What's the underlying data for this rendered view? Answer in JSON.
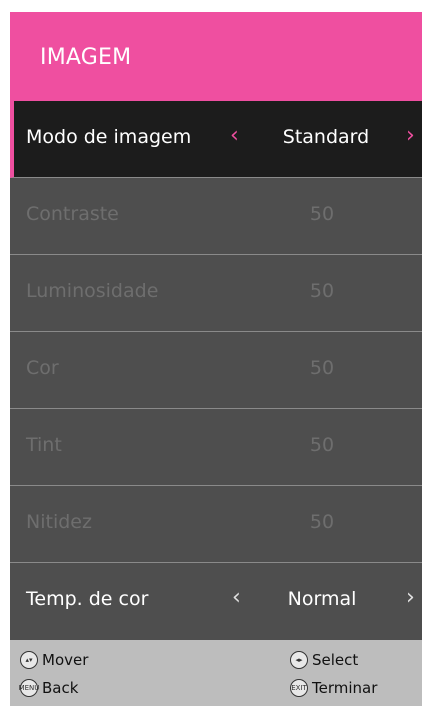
{
  "menu": {
    "title": "IMAGEM",
    "items": [
      {
        "label": "Modo de imagem",
        "value": "Standard",
        "state": "active",
        "arrows": true
      },
      {
        "label": "Contraste",
        "value": "50",
        "state": "dim",
        "arrows": false
      },
      {
        "label": "Luminosidade",
        "value": "50",
        "state": "dim",
        "arrows": false
      },
      {
        "label": "Cor",
        "value": "50",
        "state": "dim",
        "arrows": false
      },
      {
        "label": "Tint",
        "value": "50",
        "state": "dim",
        "arrows": false
      },
      {
        "label": "Nitidez",
        "value": "50",
        "state": "dim",
        "arrows": false
      },
      {
        "label": "Temp. de cor",
        "value": "Normal",
        "state": "normal",
        "arrows": true
      }
    ]
  },
  "footer": {
    "move": "Mover",
    "select": "Select",
    "back": "Back",
    "exit": "Terminar",
    "menu_icon_text": "MENU",
    "exit_icon_text": "EXIT"
  },
  "colors": {
    "accent": "#ef4fa0",
    "menu_bg": "#4e4e4e",
    "active_row_bg": "#1c1c1c",
    "footer_bg": "#bdbdbd"
  }
}
